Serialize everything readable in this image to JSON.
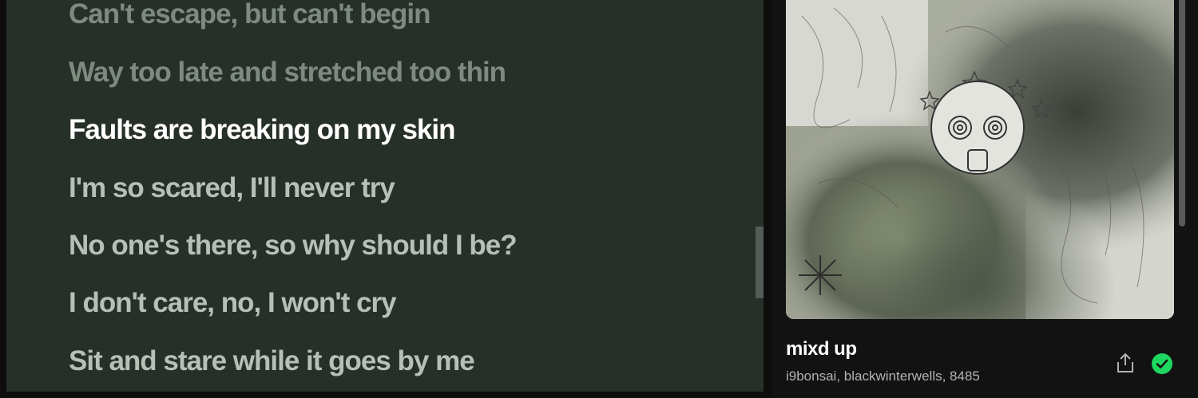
{
  "lyrics": {
    "lines": [
      {
        "text": "Can't escape, but can't begin",
        "state": "past"
      },
      {
        "text": "Way too late and stretched too thin",
        "state": "past"
      },
      {
        "text": "Faults are breaking on my skin",
        "state": "active"
      },
      {
        "text": "I'm so scared, I'll never try",
        "state": "upcoming"
      },
      {
        "text": "No one's there, so why should I be?",
        "state": "upcoming"
      },
      {
        "text": "I don't care, no, I won't cry",
        "state": "upcoming"
      },
      {
        "text": "Sit and stare while it goes by me",
        "state": "upcoming"
      }
    ],
    "background_color": "#273028",
    "active_color": "#ffffff",
    "upcoming_color": "#b6c0b7",
    "past_color": "#7e8a80"
  },
  "now_playing": {
    "title": "mixd up",
    "artists": "i9bonsai, blackwinterwells, 8485",
    "share_icon": "share-icon",
    "saved_icon": "check-circle-icon",
    "saved_color": "#1ed760"
  }
}
